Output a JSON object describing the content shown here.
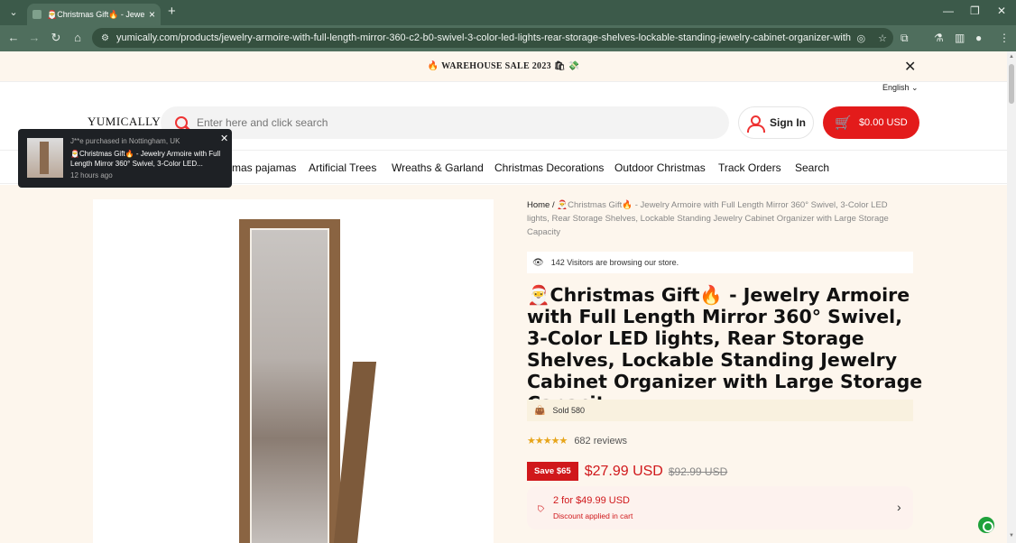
{
  "browser": {
    "tab_title": "🎅Christmas Gift🔥 - Jewelry A",
    "url": "yumically.com/products/jewelry-armoire-with-full-length-mirror-360-c2-b0-swivel-3-color-led-lights-rear-storage-shelves-lockable-standing-jewelry-cabinet-organizer-with-large-storage-capacity"
  },
  "announcement": {
    "text": "🔥 WAREHOUSE SALE 2023 🛍 💸"
  },
  "header": {
    "language": "English",
    "logo": "YUMICALLY",
    "search_placeholder": "Enter here and click search",
    "signin_label": "Sign In",
    "cart_label": "$0.00 USD"
  },
  "nav": {
    "items": [
      "mas pajamas",
      "Artificial Trees",
      "Wreaths & Garland",
      "Christmas Decorations",
      "Outdoor Christmas",
      "Track Orders",
      "Search"
    ]
  },
  "toast": {
    "line1": "J**e purchased in Nottingham, UK",
    "line2": "🎅Christmas Gift🔥 - Jewelry Armoire with Full Length Mirror 360° Swivel, 3-Color LED...",
    "line3": "12 hours ago"
  },
  "product": {
    "breadcrumb_home": "Home /",
    "breadcrumb_current": "🎅Christmas Gift🔥 - Jewelry Armoire with Full Length Mirror 360° Swivel, 3-Color LED lights, Rear Storage Shelves, Lockable Standing Jewelry Cabinet Organizer with Large Storage Capacity",
    "visitors": "142 Visitors are browsing our store.",
    "title": "🎅Christmas Gift🔥 - Jewelry Armoire with Full Length Mirror 360° Swivel, 3-Color LED lights, Rear Storage Shelves, Lockable Standing Jewelry Cabinet Organizer with Large Storage Capacity",
    "sold": "Sold 580",
    "rating": 4.5,
    "stars": "★★★★★",
    "reviews": "682 reviews",
    "save_badge": "Save $65",
    "price": "$27.99 USD",
    "compare_price": "$92.99 USD",
    "bundle_offer": "2 for $49.99 USD",
    "bundle_note": "Discount applied in cart"
  },
  "colors": {
    "accent": "#e31b1b",
    "chrome": "#4f6e5d",
    "announce_bg": "#fdf6ed"
  }
}
